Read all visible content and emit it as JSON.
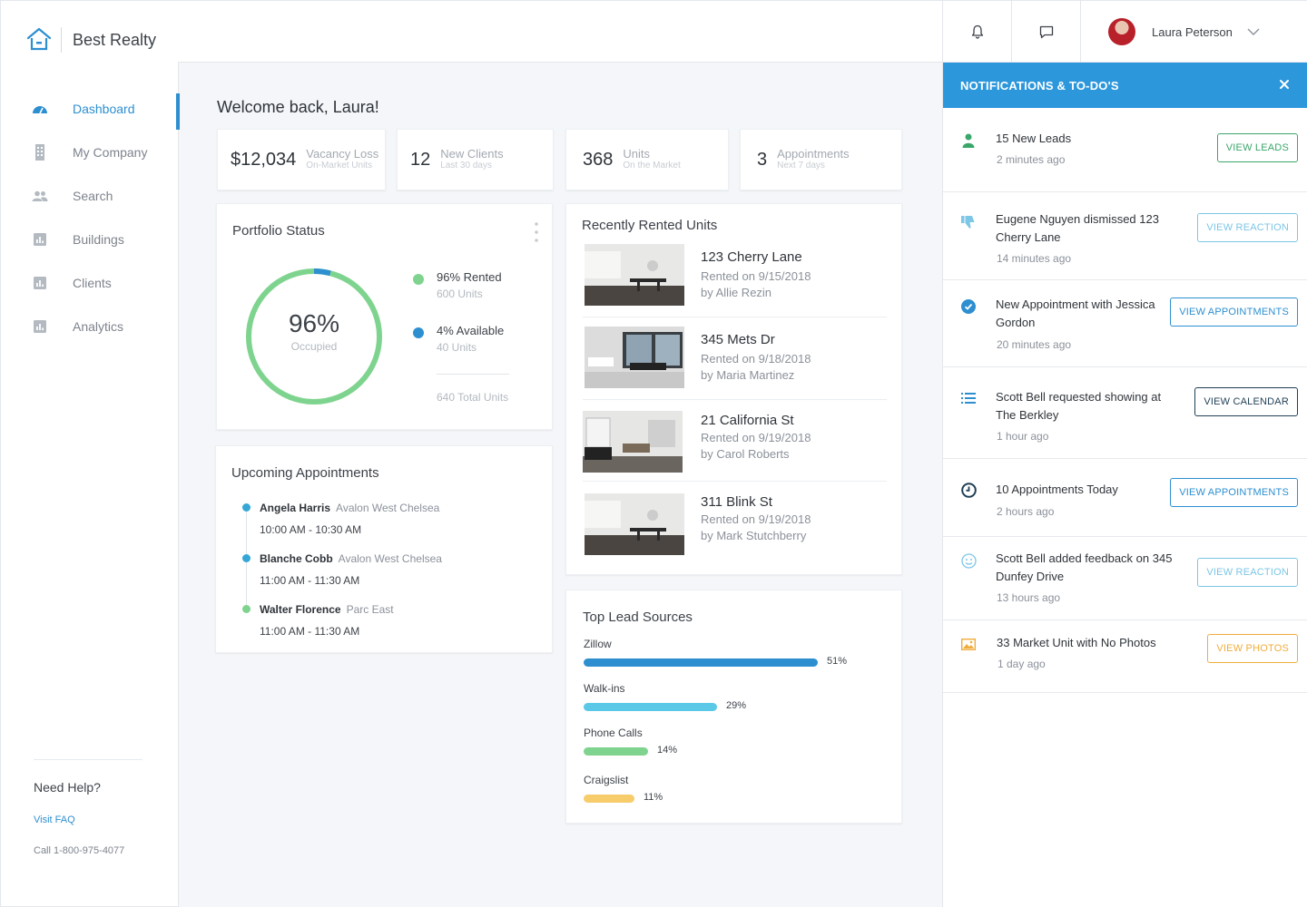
{
  "brand": {
    "name": "Best Realty"
  },
  "sidebar": {
    "items": [
      {
        "label": "Dashboard",
        "icon": "gauge-icon",
        "active": true
      },
      {
        "label": "My Company",
        "icon": "building-icon"
      },
      {
        "label": "Search",
        "icon": "people-icon"
      },
      {
        "label": "Buildings",
        "icon": "bar-chart-icon"
      },
      {
        "label": "Clients",
        "icon": "bar-chart-icon"
      },
      {
        "label": "Analytics",
        "icon": "bar-chart-icon"
      }
    ],
    "help": {
      "title": "Need Help?",
      "faq": "Visit FAQ",
      "phone": "Call 1-800-975-4077"
    }
  },
  "topbar": {
    "user_name": "Laura Peterson"
  },
  "main": {
    "welcome": "Welcome back, Laura!",
    "stats": [
      {
        "value": "$12,034",
        "label": "Vacancy Loss",
        "sub": "On-Market Units"
      },
      {
        "value": "12",
        "label": "New Clients",
        "sub": "Last 30 days"
      },
      {
        "value": "368",
        "label": "Units",
        "sub": "On the Market"
      },
      {
        "value": "3",
        "label": "Appointments",
        "sub": "Next 7 days"
      }
    ],
    "portfolio": {
      "title": "Portfolio Status",
      "center_value": "96%",
      "center_label": "Occupied",
      "occupied_fraction": 0.96,
      "legend": [
        {
          "label": "96% Rented",
          "sub": "600 Units",
          "color": "#7ed48e"
        },
        {
          "label": "4% Available",
          "sub": "40 Units",
          "color": "#2d8fd0"
        }
      ],
      "total": "640 Total Units"
    },
    "appointments": {
      "title": "Upcoming Appointments",
      "items": [
        {
          "name": "Angela Harris",
          "location": "Avalon West Chelsea",
          "time": "10:00 AM - 10:30 AM",
          "color": "#35a7d6"
        },
        {
          "name": "Blanche Cobb",
          "location": "Avalon West Chelsea",
          "time": "11:00 AM - 11:30 AM",
          "color": "#35a7d6"
        },
        {
          "name": "Walter Florence",
          "location": "Parc East",
          "time": "11:00 AM - 11:30 AM",
          "color": "#7ed48e"
        }
      ]
    },
    "rented": {
      "title": "Recently Rented Units",
      "items": [
        {
          "title": "123 Cherry Lane",
          "date": "Rented on 9/15/2018",
          "by": "by Allie Rezin"
        },
        {
          "title": "345 Mets Dr",
          "date": "Rented on 9/18/2018",
          "by": "by Maria Martinez"
        },
        {
          "title": "21 California St",
          "date": "Rented on 9/19/2018",
          "by": "by Carol Roberts"
        },
        {
          "title": "311 Blink St",
          "date": "Rented on 9/19/2018",
          "by": "by Mark Stutchberry"
        }
      ]
    },
    "leads": {
      "title": "Top Lead Sources",
      "items": [
        {
          "label": "Zillow",
          "pct": "51%",
          "value": 51,
          "color": "#2d8fd0"
        },
        {
          "label": "Walk-ins",
          "pct": "29%",
          "value": 29,
          "color": "#5bc8e8"
        },
        {
          "label": "Phone Calls",
          "pct": "14%",
          "value": 14,
          "color": "#7ed48e"
        },
        {
          "label": "Craigslist",
          "pct": "11%",
          "value": 11,
          "color": "#f7cc6a"
        }
      ]
    }
  },
  "notifications": {
    "title": "NOTIFICATIONS & TO-DO'S",
    "items": [
      {
        "text": "15 New Leads",
        "time": "2 minutes ago",
        "button": "VIEW LEADS",
        "icon": "person-icon",
        "color": "#3aa66a"
      },
      {
        "text": "Eugene Nguyen dismissed 123 Cherry Lane",
        "time": "14 minutes ago",
        "button": "VIEW REACTION",
        "icon": "thumbs-down-icon",
        "color": "#7cc6e6"
      },
      {
        "text": "New Appointment with Jessica Gordon",
        "time": "20 minutes ago",
        "button": "VIEW APPOINTMENTS",
        "icon": "check-circle-icon",
        "color": "#2d8fd0"
      },
      {
        "text": "Scott Bell requested showing at The Berkley",
        "time": "1 hour ago",
        "button": "VIEW CALENDAR",
        "icon": "list-icon",
        "color": "#1f3f55"
      },
      {
        "text": "10 Appointments Today",
        "time": "2 hours ago",
        "button": "VIEW APPOINTMENTS",
        "icon": "clock-icon",
        "color": "#2d8fd0"
      },
      {
        "text": "Scott Bell added feedback on 345 Dunfey Drive",
        "time": "13 hours ago",
        "button": "VIEW REACTION",
        "icon": "smiley-icon",
        "color": "#7cc6e6"
      },
      {
        "text": "33 Market Unit with No Photos",
        "time": "1 day ago",
        "button": "VIEW PHOTOS",
        "icon": "image-icon",
        "color": "#f0ad3c"
      }
    ]
  }
}
